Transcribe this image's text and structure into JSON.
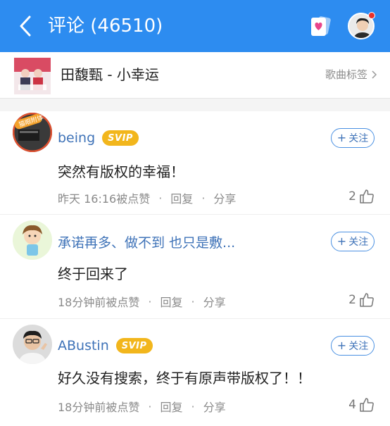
{
  "header": {
    "title": "评论 (46510)",
    "background": "#2d8cf0"
  },
  "song": {
    "title": "田馥甄 - 小幸运",
    "tag_label": "歌曲标签"
  },
  "comments": [
    {
      "name": "being",
      "vip_badge": "SVIP",
      "follow_label": "关注",
      "text": "突然有版权的幸福！",
      "time": "昨天 16:16被点赞",
      "reply_label": "回复",
      "share_label": "分享",
      "likes": "2",
      "avatar_badge_text": "猫眼附体"
    },
    {
      "name": "承诺再多、做不到  也只是敷...",
      "vip_badge": "",
      "follow_label": "关注",
      "text": "终于回来了",
      "time": "18分钟前被点赞",
      "reply_label": "回复",
      "share_label": "分享",
      "likes": "2"
    },
    {
      "name": "ABustin",
      "vip_badge": "SVIP",
      "follow_label": "关注",
      "text": "好久没有搜索，终于有原声带版权了！！",
      "time": "18分钟前被点赞",
      "reply_label": "回复",
      "share_label": "分享",
      "likes": "4"
    }
  ],
  "colors": {
    "accent": "#2d8cf0",
    "username": "#3f73b8",
    "svip": "#f2b61c",
    "notify_dot": "#e8312a"
  },
  "icons": [
    "back-arrow-icon",
    "card-heart-icon",
    "user-avatar-icon",
    "chevron-right-icon",
    "thumb-up-icon",
    "plus-icon"
  ]
}
